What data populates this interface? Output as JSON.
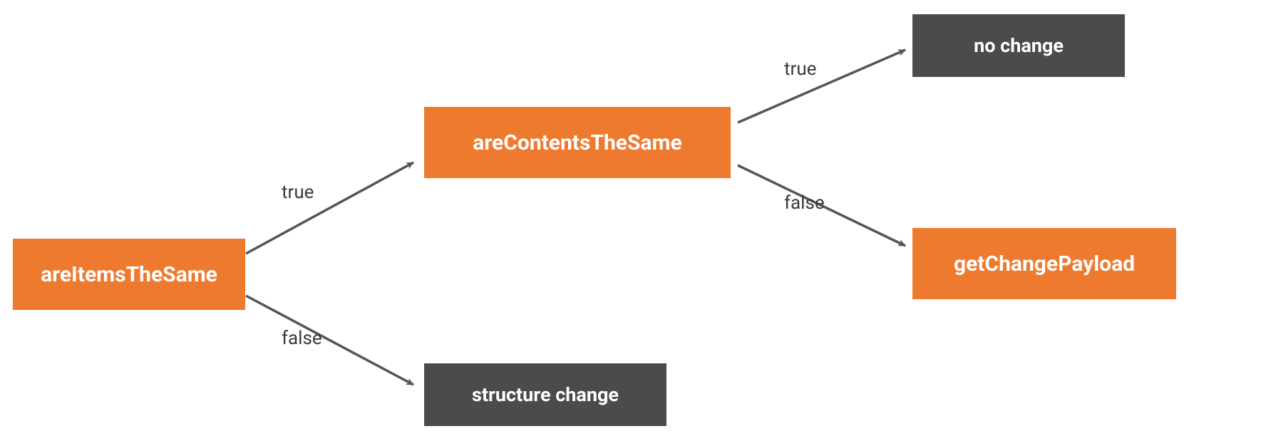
{
  "colors": {
    "orange": "#ee7a30",
    "dark": "#4b4b4b",
    "arrow": "#555555",
    "text": "#3a3a3a"
  },
  "nodes": {
    "areItemsTheSame": {
      "label": "areItemsTheSame",
      "type": "decision",
      "color": "orange"
    },
    "areContentsTheSame": {
      "label": "areContentsTheSame",
      "type": "decision",
      "color": "orange"
    },
    "getChangePayload": {
      "label": "getChangePayload",
      "type": "result",
      "color": "orange"
    },
    "noChange": {
      "label": "no change",
      "type": "result",
      "color": "dark"
    },
    "structureChange": {
      "label": "structure change",
      "type": "result",
      "color": "dark"
    }
  },
  "edges": [
    {
      "from": "areItemsTheSame",
      "to": "areContentsTheSame",
      "label": "true"
    },
    {
      "from": "areItemsTheSame",
      "to": "structureChange",
      "label": "false"
    },
    {
      "from": "areContentsTheSame",
      "to": "noChange",
      "label": "true"
    },
    {
      "from": "areContentsTheSame",
      "to": "getChangePayload",
      "label": "false"
    }
  ]
}
